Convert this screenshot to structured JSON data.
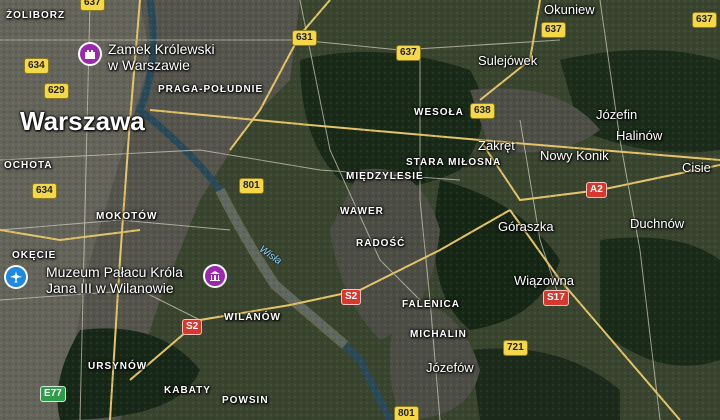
{
  "cities": {
    "warszawa": "Warszawa"
  },
  "towns": {
    "okuniew": "Okuniew",
    "sulejowek": "Sulejówek",
    "jozefin": "Józefin",
    "halinow": "Halinów",
    "zakret": "Zakręt",
    "nowy_konik": "Nowy Konik",
    "cisie": "Cisie",
    "duchnow": "Duchnów",
    "goraszka": "Góraszka",
    "wiazowna": "Wiązowna",
    "jozefow": "Józefów"
  },
  "districts": {
    "zoliborz": "ŻOLIBORZ",
    "praga_poludnie": "PRAGA-POŁUDNIE",
    "wesola": "WESOŁA",
    "ochota": "OCHOTA",
    "stara_milosna": "STARA MIŁOSNA",
    "miedzylesie": "MIĘDZYLESIE",
    "mokotow": "MOKOTÓW",
    "wawer": "WAWER",
    "okecie": "OKĘCIE",
    "radosc": "RADOŚĆ",
    "falenica": "FALENICA",
    "wilanow": "WILANÓW",
    "michalin": "MICHALIN",
    "ursynow": "URSYNÓW",
    "kabaty": "KABATY",
    "powsin": "POWSIN"
  },
  "pois": {
    "zamek_line1": "Zamek Królewski",
    "zamek_line2": "w Warszawie",
    "muzeum_line1": "Muzeum Pałacu Króla",
    "muzeum_line2": "Jana III w Wilanowie"
  },
  "river": "Wisła",
  "road_shields": {
    "r637_top": "637",
    "r637_b": "637",
    "r637_c": "637",
    "r631": "631",
    "r634_a": "634",
    "r629": "629",
    "r638": "638",
    "r634_b": "634",
    "r801_a": "801",
    "a2": "A2",
    "s2_a": "S2",
    "s17": "S17",
    "s2_b": "S2",
    "r721": "721",
    "e77": "E77",
    "r801_b": "801"
  },
  "colors": {
    "road_major": "#e3c469",
    "road_minor": "#d8d2bf",
    "river": "#2a4a5a",
    "forest": "#152515",
    "urban": "#5b5a52",
    "fields": "#3b4a2e",
    "poi_pin": "#9c27b0",
    "airport_pin": "#1e88e5"
  }
}
